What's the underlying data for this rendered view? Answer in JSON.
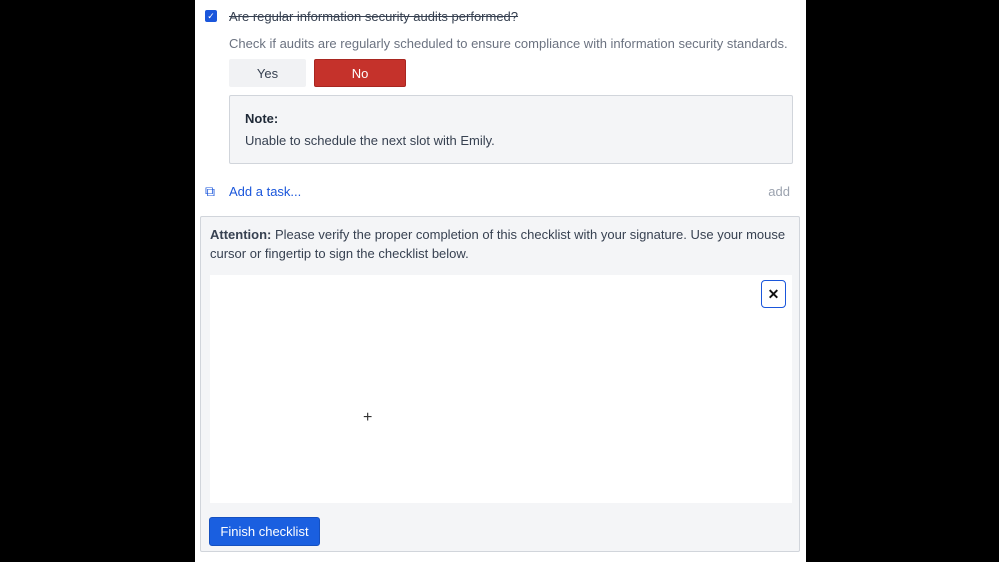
{
  "question": {
    "title": "Are regular information security audits performed?",
    "description": "Check if audits are regularly scheduled to ensure compliance with information security standards.",
    "checked": true,
    "yes_label": "Yes",
    "no_label": "No",
    "selected": "No"
  },
  "note": {
    "label": "Note:",
    "text": "Unable to schedule the next slot with Emily."
  },
  "task": {
    "placeholder": "Add a task...",
    "add_label": "add"
  },
  "signature": {
    "attention_label": "Attention:",
    "attention_text": " Please verify the proper completion of this checklist with your signature. Use your mouse cursor or fingertip to sign the checklist below.",
    "clear_label": "✕",
    "finish_label": "Finish checklist"
  },
  "colors": {
    "accent": "#1a56db",
    "no_selected": "#c5322b"
  }
}
